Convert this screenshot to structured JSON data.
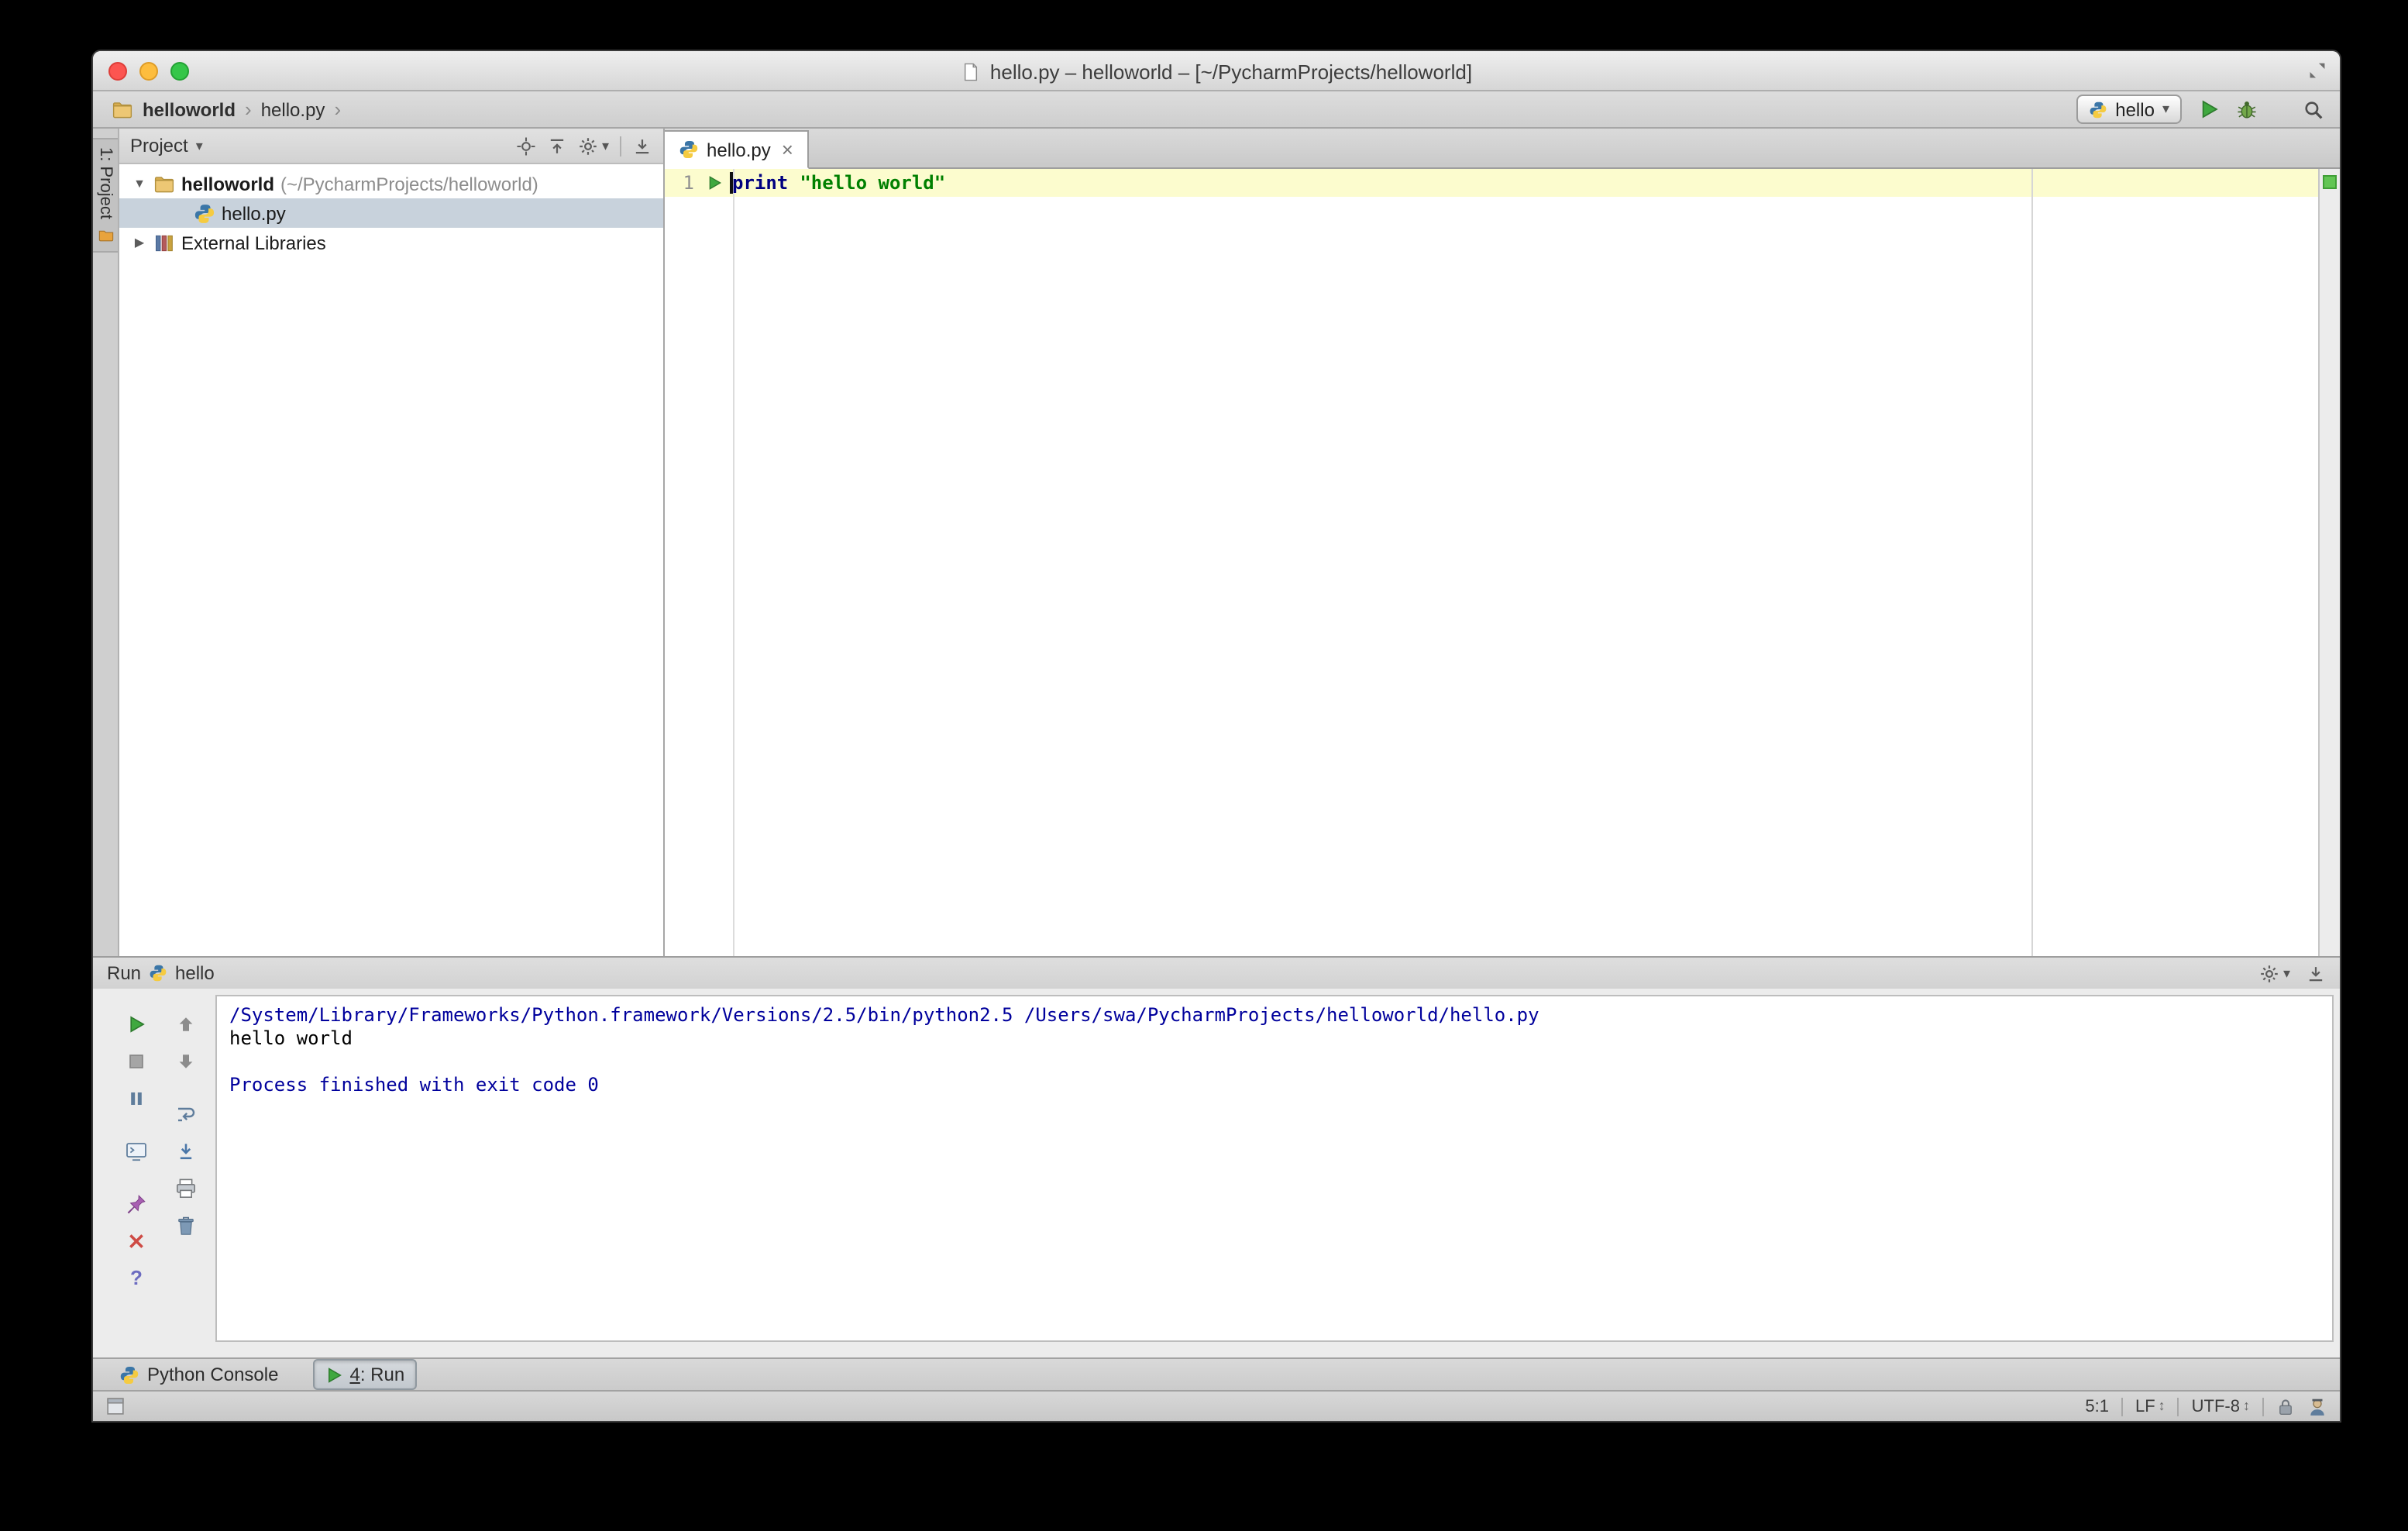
{
  "window": {
    "title": "hello.py – helloworld – [~/PycharmProjects/helloworld]"
  },
  "icons": {
    "chevron": "›",
    "dropdown_arrow": "▾",
    "expanded_arrow": "▼",
    "collapsed_arrow": "▶",
    "close": "×",
    "help": "?",
    "updown": "↕"
  },
  "breadcrumb": {
    "project": "helloworld",
    "file": "hello.py"
  },
  "toolbar": {
    "run_config": "hello"
  },
  "tool_stripe": {
    "project_button": "1: Project"
  },
  "project_panel": {
    "header": "Project",
    "root_label": "helloworld",
    "root_path": "(~/PycharmProjects/helloworld)",
    "file": "hello.py",
    "external_libraries": "External Libraries"
  },
  "editor": {
    "tab_label": "hello.py",
    "line_number": "1",
    "keyword": "print",
    "string": "\"hello world\""
  },
  "run_panel": {
    "title": "Run",
    "config_name": "hello",
    "console": {
      "line1": "/System/Library/Frameworks/Python.framework/Versions/2.5/bin/python2.5 /Users/swa/PycharmProjects/helloworld/hello.py",
      "line2": "hello world",
      "line3": "",
      "line4": "Process finished with exit code 0"
    }
  },
  "toolwindow_bar": {
    "python_console": "Python Console",
    "run_number": "4",
    "run_suffix": ": Run"
  },
  "status_bar": {
    "caret_position": "5:1",
    "line_separator": "LF",
    "encoding": "UTF-8"
  }
}
